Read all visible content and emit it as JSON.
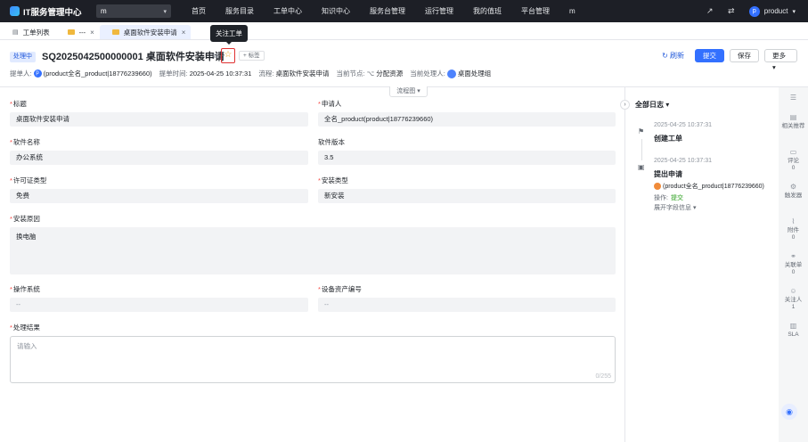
{
  "app": {
    "title": "IT服务管理中心",
    "workspace": "m"
  },
  "nav": {
    "items": [
      "首页",
      "服务目录",
      "工单中心",
      "知识中心",
      "服务台管理",
      "运行管理",
      "我的值班",
      "平台管理",
      "m"
    ]
  },
  "user": {
    "avatar": "p",
    "name": "product"
  },
  "tabs": [
    {
      "label": "工单列表"
    },
    {
      "label": "---"
    },
    {
      "label": "桌面软件安装申请"
    }
  ],
  "tooltip": "关注工单",
  "ticket": {
    "status": "处理中",
    "title": "SQ2025042500000001 桌面软件安装申请",
    "tag_button": "+ 标签",
    "applicant_label": "提单人:",
    "applicant": "(product全名_product|18776239660)",
    "submit_time_label": "提单时间:",
    "submit_time": "2025-04-25 10:37:31",
    "process_label": "流程:",
    "process": "桌面软件安装申请",
    "node_label": "当前节点:",
    "node": "分配资源",
    "handler_label": "当前处理人:",
    "handler": "桌面处理组"
  },
  "actions": {
    "refresh": "刷新",
    "submit": "提交",
    "save": "保存",
    "more": "更多"
  },
  "flow_tab": "流程图",
  "form": {
    "title_label": "标题",
    "title_value": "桌面软件安装申请",
    "applicant_label": "申请人",
    "applicant_value": "全名_product(product|18776239660)",
    "software_name_label": "软件名称",
    "software_name_value": "办公系统",
    "software_version_label": "软件版本",
    "software_version_value": "3.5",
    "license_type_label": "许可证类型",
    "license_type_value": "免费",
    "install_type_label": "安装类型",
    "install_type_value": "新安装",
    "install_reason_label": "安装原因",
    "install_reason_value": "换电脑",
    "os_label": "操作系统",
    "os_value": "--",
    "asset_no_label": "设备资产编号",
    "asset_no_value": "--",
    "result_label": "处理结果",
    "result_placeholder": "请输入",
    "result_counter": "0/255"
  },
  "log": {
    "title": "全部日志",
    "entries": [
      {
        "time": "2025-04-25 10:37:31",
        "action": "创建工单"
      },
      {
        "time": "2025-04-25 10:37:31",
        "action": "提出申请",
        "user": "(product全名_product|18776239660)",
        "op_label": "操作:",
        "op_value": "提交",
        "expand": "展开字段信息"
      }
    ]
  },
  "rail": {
    "items": [
      {
        "label": "",
        "count": ""
      },
      {
        "label": "相关推荐",
        "count": ""
      },
      {
        "label": "评论",
        "count": "0"
      },
      {
        "label": "触发器",
        "count": ""
      },
      {
        "label": "附件",
        "count": "0"
      },
      {
        "label": "关联单",
        "count": "0"
      },
      {
        "label": "关注人",
        "count": "1"
      },
      {
        "label": "SLA",
        "count": ""
      }
    ]
  }
}
